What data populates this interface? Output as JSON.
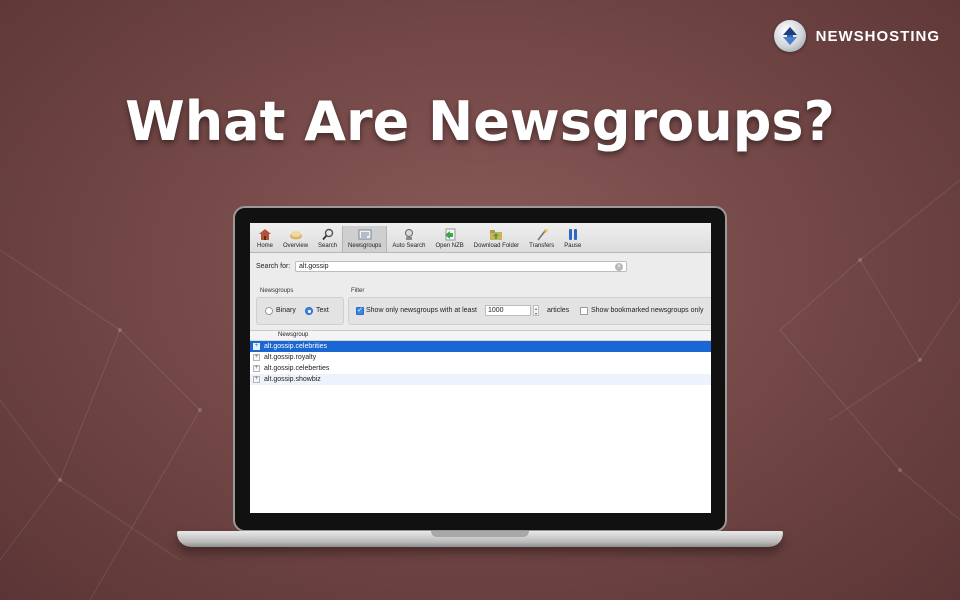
{
  "brand": {
    "name": "NEWSHOSTING",
    "icon": "newshosting-logo-icon"
  },
  "headline": "What Are Newsgroups?",
  "app": {
    "toolbar": [
      {
        "label": "Home",
        "icon": "home-icon"
      },
      {
        "label": "Overview",
        "icon": "overview-icon"
      },
      {
        "label": "Search",
        "icon": "search-icon"
      },
      {
        "label": "Newsgroups",
        "icon": "newsgroups-icon",
        "active": true
      },
      {
        "label": "Auto Search",
        "icon": "auto-search-icon"
      },
      {
        "label": "Open NZB",
        "icon": "open-nzb-icon"
      },
      {
        "label": "Download Folder",
        "icon": "download-folder-icon"
      },
      {
        "label": "Transfers",
        "icon": "transfers-icon"
      },
      {
        "label": "Pause",
        "icon": "pause-icon"
      }
    ],
    "search": {
      "label": "Search for:",
      "value": "alt.gossip"
    },
    "newsgroups_group": {
      "title": "Newsgroups",
      "binary": "Binary",
      "text": "Text",
      "selected": "Text"
    },
    "filter_group": {
      "title": "Filter",
      "show_min_label": "Show only newsgroups with at least",
      "min_value": "1000",
      "articles_label": "articles",
      "bookmarked_label": "Show bookmarked newsgroups only",
      "show_min_checked": true,
      "bookmarked_checked": false
    },
    "list": {
      "header": "Newsgroup",
      "rows": [
        "alt.gossip.celebrities",
        "alt.gossip.royalty",
        "alt.gossip.celeberties",
        "alt.gossip.showbiz"
      ],
      "selected_index": 0
    }
  },
  "colors": {
    "background": "#754948",
    "selection": "#1a66d2",
    "accent": "#3d86e6"
  }
}
